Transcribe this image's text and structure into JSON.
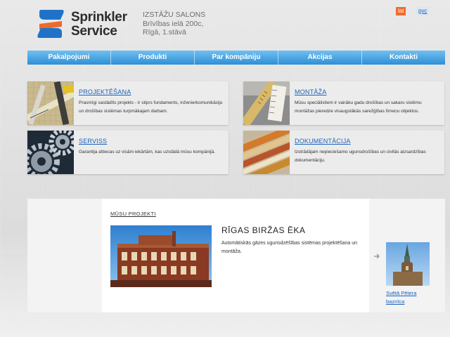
{
  "brand": {
    "line1": "Sprinkler",
    "line2": "Service",
    "colors": {
      "blue": "#1e73c8",
      "orange": "#ee6a2c"
    }
  },
  "address": {
    "line1": "IZSTĀŽU SALONS",
    "line2": "Brīvības ielā 200c,",
    "line3": "Rīgā, 1.stāvā"
  },
  "languages": {
    "active": "lat",
    "other": "рус"
  },
  "nav": {
    "items": [
      {
        "label": "Pakalpojumi"
      },
      {
        "label": "Produkti"
      },
      {
        "label": "Par kompāniju"
      },
      {
        "label": "Akcijas"
      },
      {
        "label": "Kontakti"
      }
    ]
  },
  "services": {
    "design": {
      "title": "PROJEKTĒŠANA",
      "text": "Prasmīgi sastādīts projekts - ir stiprs fundaments, inženierkomunikāciju un drošības sistēmas turpmākajam darbam.",
      "icon": "blueprint-tools-icon"
    },
    "install": {
      "title": "MONTĀŽA",
      "text": "Mūsu speciālistiem ir vairāku gadu drošības un sakaru sistēmu montāžas pieredze visaugstākās sarežģības līmeņu objektos.",
      "icon": "measuring-tools-icon"
    },
    "service": {
      "title": "SERVISS",
      "text": "Garantija attiecas uz visām iekārtām, kas uzstādā mūsu kompānijā.",
      "icon": "gears-icon"
    },
    "docs": {
      "title": "DOKUMENTĀCIJA",
      "text": "Izstrādājam nepieciešamo ugunsdrošības un civilās aizsardzības dokumentāciju.",
      "icon": "document-folders-icon"
    }
  },
  "projects": {
    "label": "MŪSU PROJEKTI",
    "featured": {
      "title": "RĪGAS BIRŽAS ĒKA",
      "description": "Automātiskās gāzes ugunsdzēšības sistēmas projektēšana un montāža."
    },
    "next": {
      "caption_line1": "Svētā Pētera",
      "caption_line2": "baznīca"
    }
  }
}
